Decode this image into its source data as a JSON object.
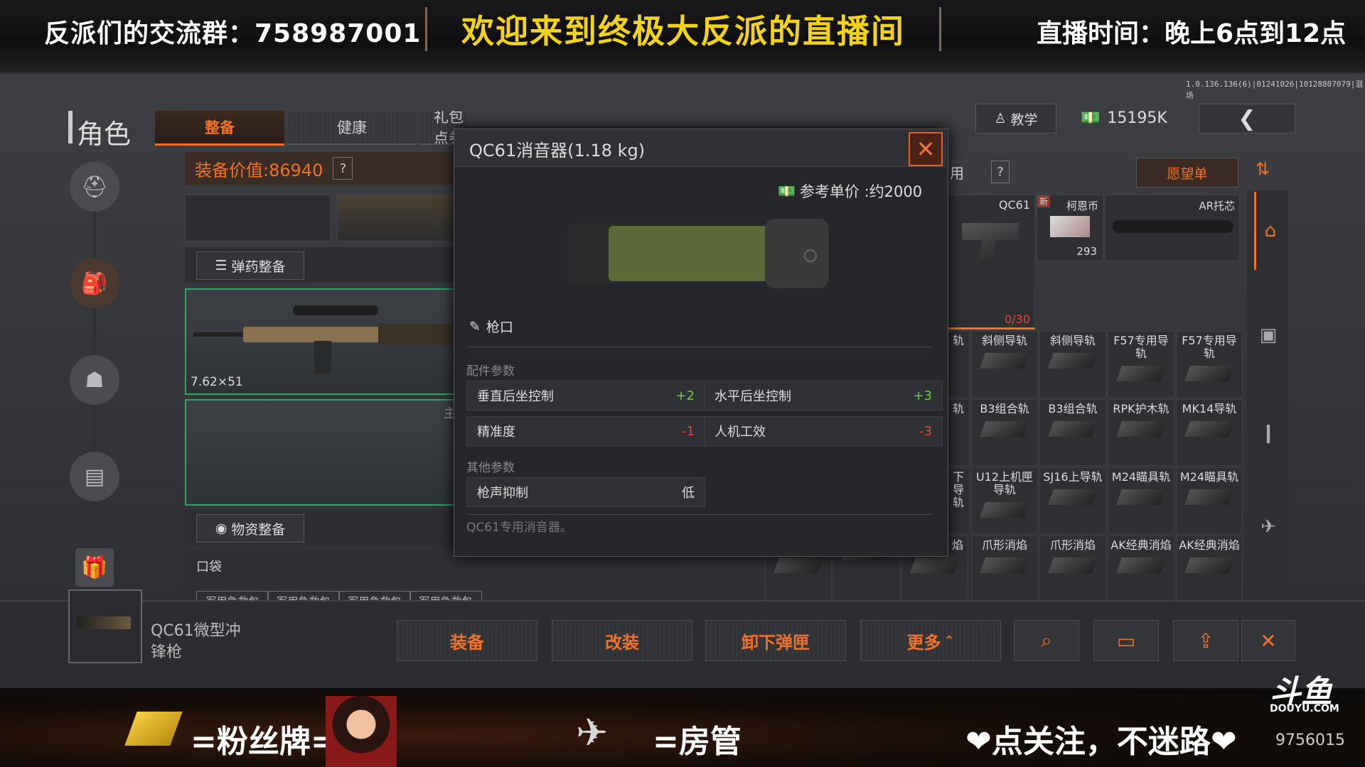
{
  "stream": {
    "group_text": "反派们的交流群：758987001",
    "welcome_text": "欢迎来到终极大反派的直播间",
    "schedule_text": "直播时间：晚上6点到12点",
    "version_text": "1.0.136.136(6)|01241026|10128807079|混场",
    "fan_badge_text": "=粉丝牌=",
    "admin_text": "=房管",
    "follow_text": "点关注，不迷路",
    "platform_logo": "斗鱼",
    "platform_domain": "DOUYU.COM",
    "room_id": "9756015"
  },
  "header": {
    "section_title": "角色",
    "tabs": [
      "整备",
      "健康",
      "礼包点券"
    ],
    "tutorial_label": "教学",
    "currency_value": "15195K",
    "back_icon": "chevron-left-icon"
  },
  "loadout": {
    "value_label": "装备价值:86940",
    "help": "?",
    "ammo_button": "弹药整备",
    "primary_caliber": "7.62×51",
    "secondary_label": "主",
    "supply_button": "物资整备",
    "pocket_label": "口袋",
    "pocket_items": [
      "军用急救包",
      "军用急救包",
      "军用急救包",
      "军用急救包"
    ]
  },
  "inventory": {
    "header_partial": "用",
    "help": "?",
    "wishlist_label": "愿望单",
    "top_items": [
      {
        "label": "QC61",
        "count": "0/30"
      },
      {
        "label": "柯恩币",
        "badge": "新",
        "count": "293"
      },
      {
        "label": "AR托芯"
      }
    ],
    "grid_items": [
      "轨",
      "斜侧导轨",
      "斜侧导轨",
      "F57专用导轨",
      "F57专用导轨",
      "轨",
      "B3组合轨",
      "B3组合轨",
      "RPK护木轨",
      "MK14导轨",
      "下导轨",
      "U12上机匣导轨",
      "SJ16上导轨",
      "M24瞄具轨",
      "M24瞄具轨",
      "轨",
      "",
      "焰",
      "爪形消焰",
      "爪形消焰",
      "AK经典消焰",
      "AK经典消焰"
    ]
  },
  "modal": {
    "title": "QC61消音器(1.18 kg)",
    "price_label": "参考单价 :约2000",
    "slot_label": "枪口",
    "param_section": "配件参数",
    "params": [
      {
        "name": "垂直后坐控制",
        "value": "+2"
      },
      {
        "name": "水平后坐控制",
        "value": "+3"
      },
      {
        "name": "精准度",
        "value": "-1"
      },
      {
        "name": "人机工效",
        "value": "-3"
      }
    ],
    "other_section": "其他参数",
    "other_params": [
      {
        "name": "枪声抑制",
        "value": "低"
      }
    ],
    "description": "QC61专用消音器。"
  },
  "selected_item": {
    "name_line1": "QC61微型冲",
    "name_line2": "锋枪"
  },
  "actions": {
    "equip": "装备",
    "modify": "改装",
    "unload": "卸下弹匣",
    "more": "更多"
  }
}
